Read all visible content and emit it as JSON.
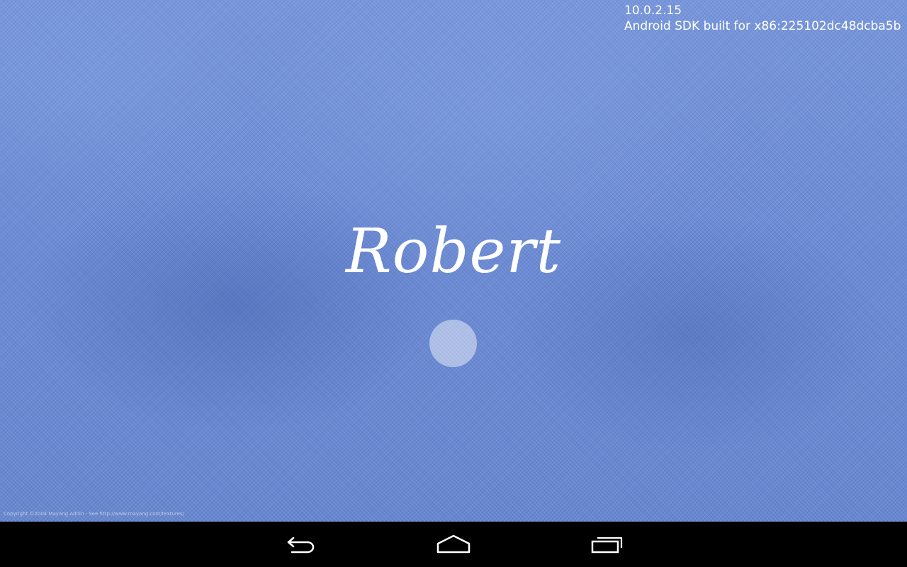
{
  "status_overlay": {
    "ip_address": "10.0.2.15",
    "device_model": "Android SDK built for x86:225102dc48dcba5b"
  },
  "lockscreen": {
    "user_name": "Robert",
    "wallpaper_credit": "Copyright ©2004 Mayang Adnin - See http://www.mayang.com/textures/"
  },
  "nav_bar": {
    "buttons": [
      {
        "name": "back",
        "icon": "back-arrow-icon"
      },
      {
        "name": "home",
        "icon": "home-icon"
      },
      {
        "name": "recents",
        "icon": "recent-apps-icon"
      }
    ]
  },
  "colors": {
    "wallpaper": "#6f8fd6",
    "nav_bar": "#000000",
    "text": "#ffffff"
  }
}
